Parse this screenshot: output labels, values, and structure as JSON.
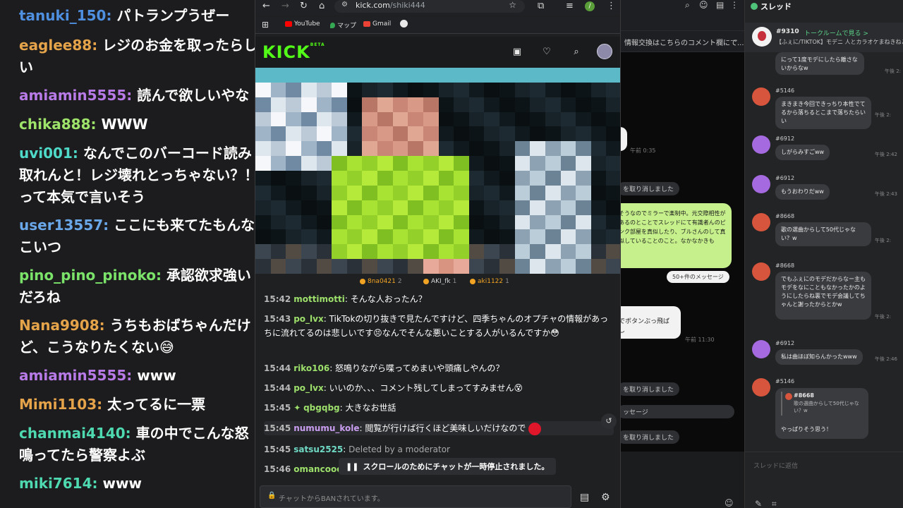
{
  "left_chat": [
    {
      "user": "tanuki_150",
      "msg": "パトランプうぜー",
      "color": "#4f8fe0"
    },
    {
      "user": "eaglee88",
      "msg": "レジのお金を取ったらしい",
      "color": "#e5a34a"
    },
    {
      "user": "amiamin5555",
      "msg": "読んで欲しいやな",
      "color": "#b77ae6"
    },
    {
      "user": "chika888",
      "msg": "WWW",
      "color": "#9ee36a"
    },
    {
      "user": "uvi001",
      "msg": "なんでこのバーコード読み取れんと！レジ壊れとっちゃない？！　って本気で言いそう",
      "color": "#4fd9c8"
    },
    {
      "user": "user13557",
      "msg": "ここにも来てたもんな こいつ",
      "color": "#6aa7e8"
    },
    {
      "user": "pino_pino_pinoko",
      "msg": "承認欲求強いだろね",
      "color": "#7be36a"
    },
    {
      "user": "Nana9908",
      "msg": "うちもおばちゃんだけど、こうなりたくない😅",
      "color": "#e5a34a"
    },
    {
      "user": "amiamin5555",
      "msg": "www",
      "color": "#b77ae6"
    },
    {
      "user": "Mimi1103",
      "msg": "太ってるに一票",
      "color": "#e5a34a"
    },
    {
      "user": "chanmai4140",
      "msg": "車の中でこんな怒鳴ってたら警察よぶ",
      "color": "#4fd9b0"
    },
    {
      "user": "miki7614",
      "msg": "www",
      "color": "#4fd9b0"
    }
  ],
  "browser": {
    "url_host": "kick.com",
    "url_path": "/shiki444",
    "bookmarks": [
      {
        "label": "YouTube",
        "color": "#ff0000"
      },
      {
        "label": "マップ",
        "color": "#34a853"
      },
      {
        "label": "Gmail",
        "color": "#ea4335"
      }
    ],
    "profile_letter": "/"
  },
  "kick": {
    "logo": "KICK",
    "logo_tag": "BETA"
  },
  "viewers": [
    {
      "name": "8na0421",
      "count": "2"
    },
    {
      "name": "AKI_fk",
      "count": "1"
    },
    {
      "name": "aki1122",
      "count": "1"
    }
  ],
  "chat": [
    {
      "time": "15:42",
      "user": "mottimotti",
      "msg": "そんな人おったん？",
      "color": "#9de06b"
    },
    {
      "time": "15:43",
      "user": "po_lvx",
      "msg": "TikTokの切り抜きで見たんですけど、四季ちゃんのオプチャの情報があっちに流れてるのは悲しいです😣なんでそんな悪いことする人がいるんですか😳",
      "color": "#9de06b"
    },
    {
      "time": "15:44",
      "user": "riko106",
      "msg": "怒鳴りながら喋ってめまいや頭痛しやんの？",
      "color": "#9de06b"
    },
    {
      "time": "15:44",
      "user": "po_lvx",
      "msg": "いいのか、、、コメント残してしまってすみません😵",
      "color": "#9de06b"
    },
    {
      "time": "15:45",
      "user": "qbgqbg",
      "msg": "大きなお世話",
      "color": "#9de06b"
    },
    {
      "time": "15:45",
      "user": "numumu_kole",
      "msg": "閲覧が行けば行くほど美味しいだけなので",
      "color": "#c99ef0"
    },
    {
      "time": "15:45",
      "user": "satsu2525",
      "msg": "Deleted by a moderator",
      "color": "#6fd9c4"
    },
    {
      "time": "15:46",
      "user": "omancooo",
      "msg": "",
      "color": "#9de06b"
    }
  ],
  "pause_text": "スクロールのためにチャットが一時停止されました。",
  "chat_input_placeholder": "チャットからBANされています。",
  "bg_app": {
    "notice": "情報交換はこちらのコメント欄にて...",
    "bubble_green": "そうなのでミラーで楽制中。元交際相性があるのとことでスレッドにて有識者んのピンク部屋を真似したり、ブルさんのして真似していることのこと。なかなかきも",
    "more_pill": "50+件のメッセージ",
    "pill_unsent_1": "を取り消しました",
    "pill_unsent_2": "を取り消しました",
    "pill_unsent_3": "を取り消しました",
    "pill_msg": "ッセージ",
    "bubble_white": "でボタンぶっ飛ばし",
    "time_1": "午前 0:35",
    "time_2": "午前 11:30"
  },
  "thread": {
    "title": "スレッド",
    "pinned_num": "#9310",
    "pinned_link": "トークルームで見る >",
    "pinned_sub": "【ふぇに/TIKTOK】モデニ 人とカラオケまねきねこに霧",
    "top_bubble": "にって1度モデにしたら離さないからなw",
    "top_time": "午後 2:",
    "messages": [
      {
        "id": "#5146",
        "text": "まきまき今回できっちり本性でてるから落ちるとこまで落ちたらいい",
        "time": "午後 2:",
        "avatar": "red"
      },
      {
        "id": "#6912",
        "text": "しがらみすごww",
        "time": "午後 2:42",
        "avatar": "purple"
      },
      {
        "id": "#6912",
        "text": "もうおわりだww",
        "time": "午後 2:43",
        "avatar": "purple"
      },
      {
        "id": "#8668",
        "text": "歌の選曲からして50代じゃない？w",
        "time": "午後 2:",
        "avatar": "red"
      },
      {
        "id": "#8668",
        "text": "でもふぇにのモデだからなー主もモデをなにこともなかったかのようにしたらね裏でモデ会議してちゃんと謝ったからとかw",
        "time": "午後 2:",
        "avatar": "red"
      },
      {
        "id": "#6912",
        "text": "私は曲ほぼ知らんかったwww",
        "time": "午後 2:46",
        "avatar": "purple"
      }
    ],
    "quote_id": "#8668",
    "quote_text": "歌の選曲からして50代じゃない？w",
    "quote_reply": "やっぱりそう思う！",
    "quote_msg_id": "#5146",
    "input_placeholder": "スレッドに返信"
  }
}
